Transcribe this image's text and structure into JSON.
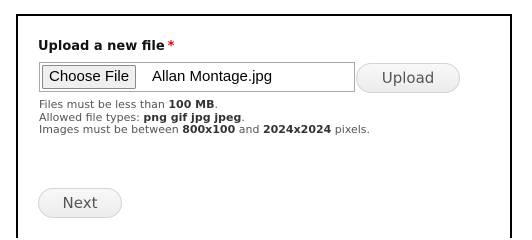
{
  "upload_form": {
    "label": "Upload a new file",
    "required_marker": "*",
    "choose_button_label": "Choose File",
    "selected_file_name": "Allan Montage.jpg",
    "upload_button_label": "Upload"
  },
  "help": {
    "line1_prefix": "Files must be less than ",
    "max_size": "100 MB",
    "line1_suffix": ".",
    "line2_prefix": "Allowed file types: ",
    "file_types": "png gif jpg jpeg",
    "line2_suffix": ".",
    "line3_prefix": "Images must be between ",
    "min_dimensions": "800x100",
    "line3_and": " and ",
    "max_dimensions": "2024x2024",
    "line3_suffix": " pixels."
  },
  "actions": {
    "next_label": "Next"
  }
}
